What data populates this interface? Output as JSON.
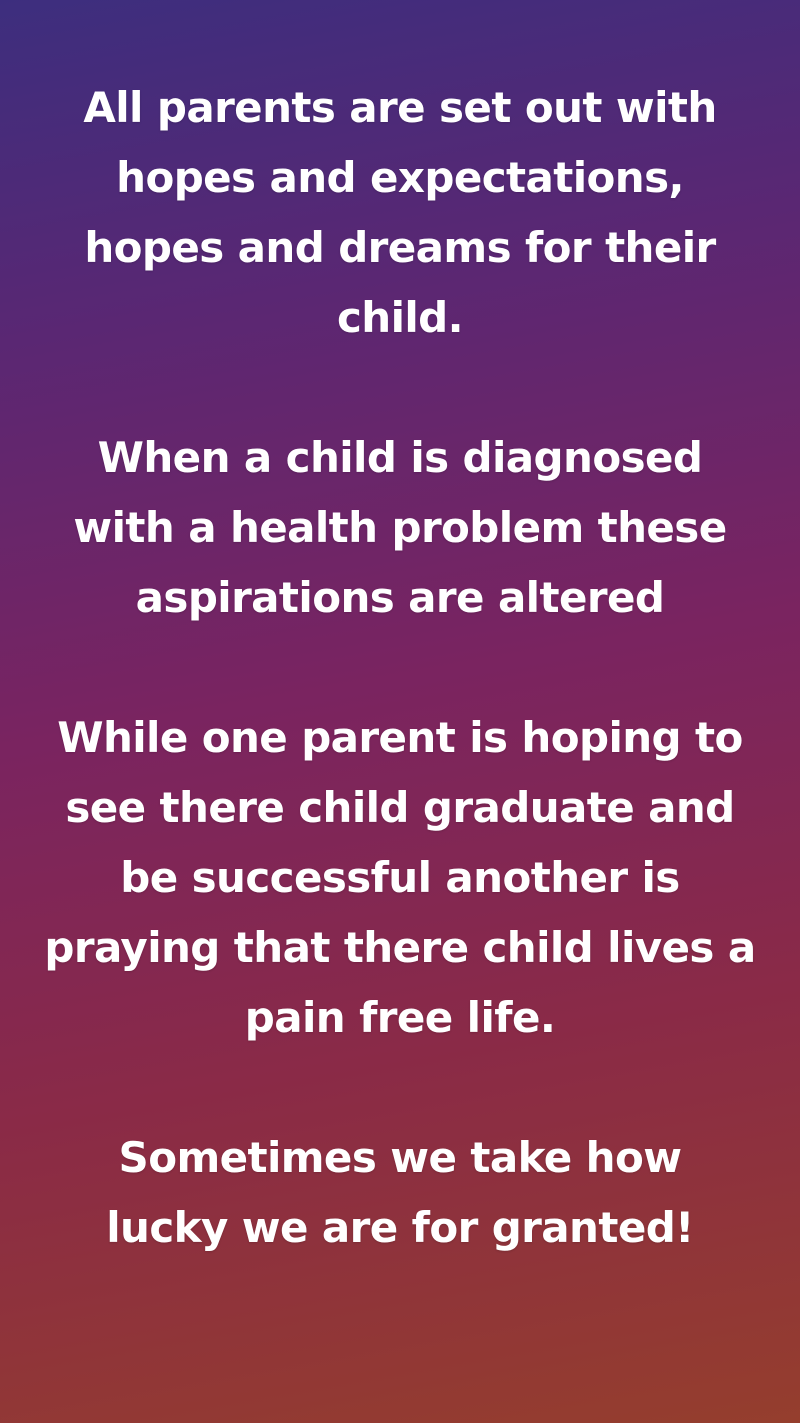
{
  "story": {
    "paragraphs": [
      {
        "lines": [
          "All parents are set out with",
          "hopes and expectations,",
          "hopes and dreams for their",
          "child."
        ]
      },
      {
        "lines": [
          "When a child is diagnosed",
          "with a health problem these",
          "aspirations are altered"
        ]
      },
      {
        "lines": [
          "While one parent is hoping to",
          "see there child graduate and",
          "be successful another is",
          "praying that there child lives a",
          "pain free life."
        ]
      },
      {
        "lines": [
          "Sometimes we take how",
          "lucky we are for granted!"
        ]
      }
    ],
    "text_color": "#ffffff",
    "gradient_colors": [
      "#3d2e7e",
      "#7a2460",
      "#953e2d"
    ]
  }
}
